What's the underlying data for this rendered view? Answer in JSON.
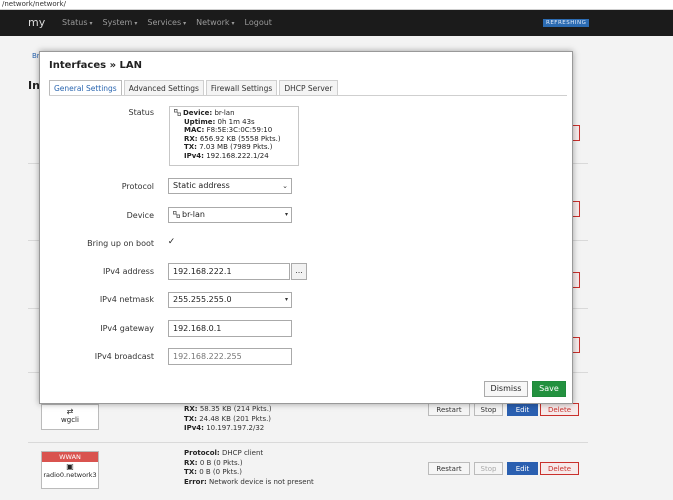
{
  "browser": {
    "url_fragment": "/network/network/"
  },
  "navbar": {
    "brand": "my",
    "menu": [
      {
        "label": "Status",
        "caret": "▾"
      },
      {
        "label": "System",
        "caret": "▾"
      },
      {
        "label": "Services",
        "caret": "▾"
      },
      {
        "label": "Network",
        "caret": "▾"
      },
      {
        "label": "Logout",
        "caret": ""
      }
    ],
    "refreshing": "REFRESHING"
  },
  "background": {
    "crumb": "Br",
    "title": "Int",
    "wgcli": {
      "name": "wgcli",
      "rx": "RX:",
      "rx_val": "58.35 KB (214 Pkts.)",
      "tx": "TX:",
      "tx_val": "24.48 KB (201 Pkts.)",
      "ipv4": "IPv4:",
      "ipv4_val": "10.197.197.2/32"
    },
    "wwan": {
      "badge": "WWAN",
      "device": "radio0.network3",
      "protocol_label": "Protocol:",
      "protocol_val": "DHCP client",
      "rx": "RX:",
      "rx_val": "0 B (0 Pkts.)",
      "tx": "TX:",
      "tx_val": "0 B (0 Pkts.)",
      "error": "Error:",
      "error_val": "Network device is not present"
    },
    "actions": {
      "restart": "Restart",
      "stop": "Stop",
      "edit": "Edit",
      "delete": "Delete"
    }
  },
  "modal": {
    "title": "Interfaces » LAN",
    "tabs": [
      "General Settings",
      "Advanced Settings",
      "Firewall Settings",
      "DHCP Server"
    ],
    "status": {
      "label": "Status",
      "device_label": "Device:",
      "device": "br-lan",
      "uptime_label": "Uptime:",
      "uptime": "0h 1m 43s",
      "mac_label": "MAC:",
      "mac": "F8:5E:3C:0C:59:10",
      "rx_label": "RX:",
      "rx": "656.92 KB (5558 Pkts.)",
      "tx_label": "TX:",
      "tx": "7.03 MB (7989 Pkts.)",
      "ipv4_label": "IPv4:",
      "ipv4": "192.168.222.1/24"
    },
    "protocol": {
      "label": "Protocol",
      "value": "Static address"
    },
    "device": {
      "label": "Device",
      "value": "br-lan"
    },
    "boot": {
      "label": "Bring up on boot",
      "check": "✓"
    },
    "ipv4_address": {
      "label": "IPv4 address",
      "value": "192.168.222.1",
      "extra": "..."
    },
    "ipv4_netmask": {
      "label": "IPv4 netmask",
      "value": "255.255.255.0"
    },
    "ipv4_gateway": {
      "label": "IPv4 gateway",
      "value": "192.168.0.1"
    },
    "ipv4_broadcast": {
      "label": "IPv4 broadcast",
      "placeholder": "192.168.222.255"
    },
    "dismiss": "Dismiss",
    "save": "Save"
  }
}
